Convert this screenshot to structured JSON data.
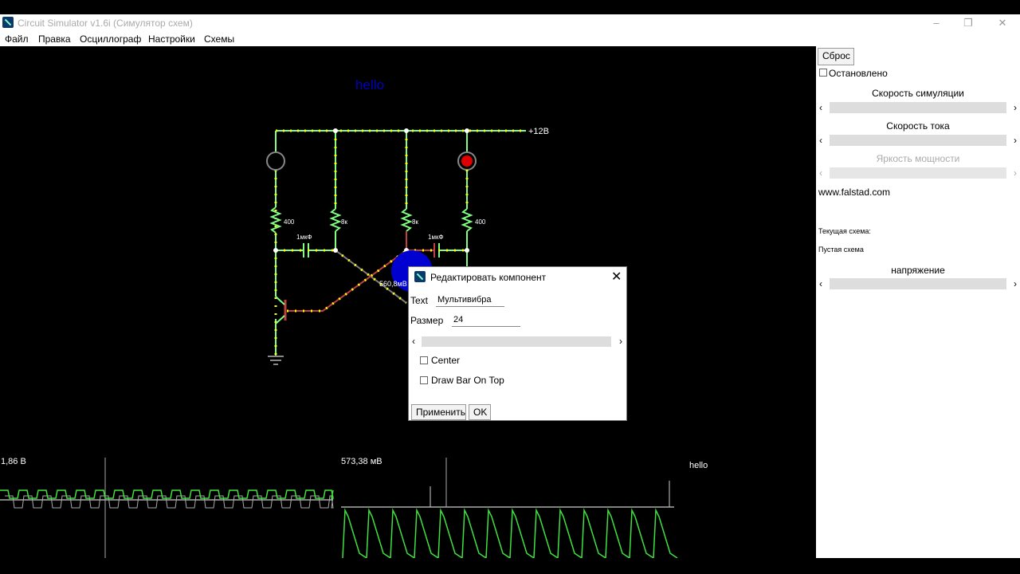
{
  "window": {
    "title": "Circuit Simulator v1.6i (Симулятор схем)",
    "min_icon": "minimize-icon",
    "max_icon": "restore-icon",
    "close_icon": "close-icon"
  },
  "menu": [
    "Файл",
    "Правка",
    "Осциллограф",
    "Настройки",
    "Схемы"
  ],
  "canvas": {
    "hello_text": "hello",
    "supply_label": "+12В",
    "resistor_labels": [
      "400",
      "8к",
      "8к",
      "400"
    ],
    "cap_labels": [
      "1мкФ",
      "1мкФ"
    ],
    "hover_value": "560,8мВ"
  },
  "scopes": {
    "left_value": "1,86 В",
    "right_value": "573,38 мВ",
    "text_label": "hello"
  },
  "sidebar": {
    "reset_button": "Сброс",
    "stopped_label": "Остановлено",
    "sim_speed_label": "Скорость симуляции",
    "current_speed_label": "Скорость тока",
    "power_brightness_label": "Яркость мощности",
    "site": "www.falstad.com",
    "current_circuit_label": "Текущая схема:",
    "current_circuit_value": "Пустая схема",
    "voltage_label": "напряжение"
  },
  "dialog": {
    "title": "Редактировать компонент",
    "text_label": "Text",
    "text_value": "Мультивибра",
    "size_label": "Размер",
    "size_value": "24",
    "center_label": "Center",
    "bar_on_top_label": "Draw Bar On Top",
    "apply_button": "Применить",
    "ok_button": "OK"
  },
  "colors": {
    "wire": "#80ff80",
    "node": "#ffffff",
    "current_dot": "#ffff00",
    "hot_wire": "#ff4040",
    "hello_text": "#0000c0",
    "lamp_on": "#e00000"
  }
}
